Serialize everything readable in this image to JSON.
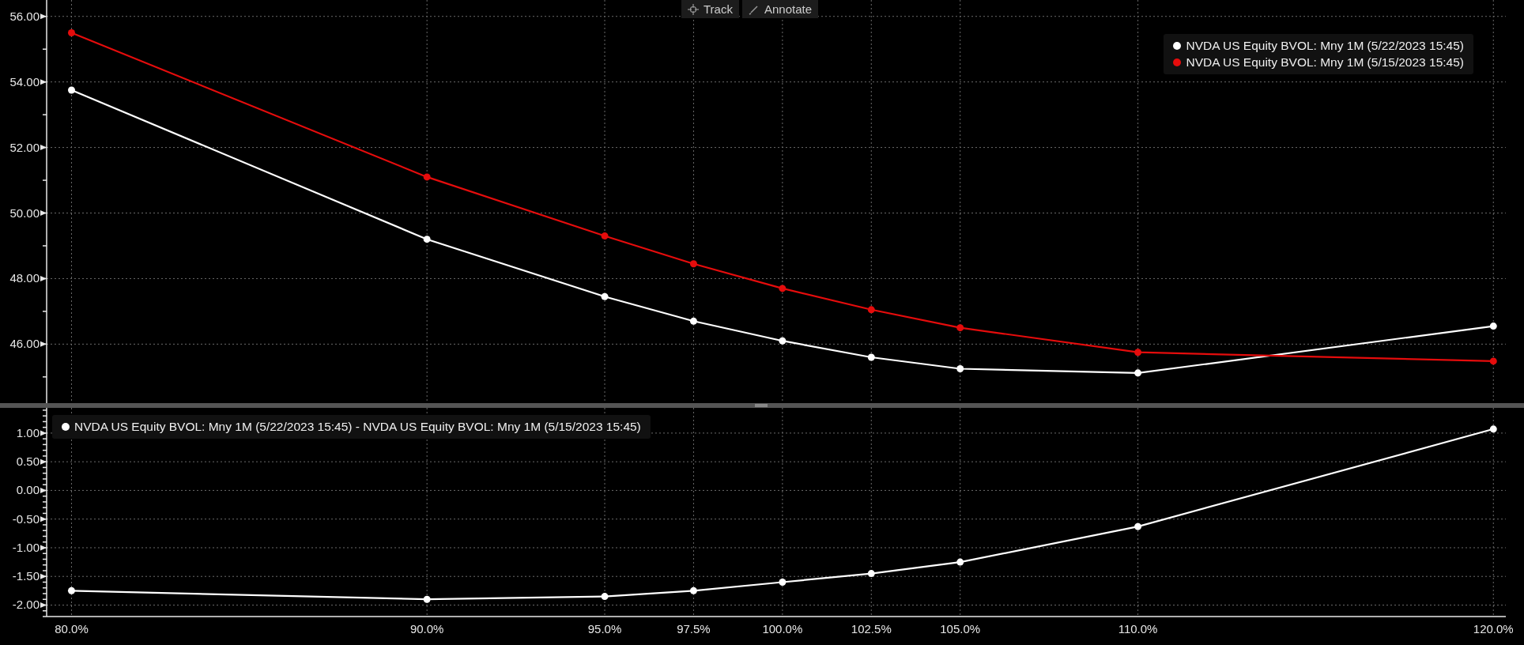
{
  "toolbar": [
    {
      "kind": "track",
      "label": "Track"
    },
    {
      "kind": "annotate",
      "label": "Annotate"
    }
  ],
  "top_panel": {
    "chart_data": {
      "type": "line",
      "x": [
        80,
        90,
        95,
        97.5,
        100,
        102.5,
        105,
        110,
        120
      ],
      "xlim": [
        79.3,
        120.35
      ],
      "ylim": [
        44.2,
        56.5
      ],
      "grid": true,
      "yticks": [
        {
          "value": 46,
          "label": "46.00"
        },
        {
          "value": 48,
          "label": "48.00"
        },
        {
          "value": 50,
          "label": "50.00"
        },
        {
          "value": 52,
          "label": "52.00"
        },
        {
          "value": 54,
          "label": "54.00"
        },
        {
          "value": 56,
          "label": "56.00"
        }
      ],
      "series": [
        {
          "name": "NVDA US Equity BVOL: Mny 1M (5/22/2023 15:45)",
          "color": "#ffffff",
          "marker": true,
          "values": [
            53.75,
            49.2,
            47.45,
            46.7,
            46.1,
            45.6,
            45.25,
            45.12,
            46.55
          ]
        },
        {
          "name": "NVDA US Equity BVOL: Mny 1M (5/15/2023 15:45)",
          "color": "#e50c0c",
          "marker": true,
          "values": [
            55.5,
            51.1,
            49.3,
            48.45,
            47.7,
            47.05,
            46.5,
            45.75,
            45.48
          ]
        }
      ]
    }
  },
  "bottom_panel": {
    "chart_data": {
      "type": "line",
      "x": [
        80,
        90,
        95,
        97.5,
        100,
        102.5,
        105,
        110,
        120
      ],
      "xlim": [
        79.3,
        120.35
      ],
      "ylim": [
        -2.2,
        1.44
      ],
      "grid": true,
      "xticks": [
        {
          "value": 80,
          "label": "80.0%"
        },
        {
          "value": 90,
          "label": "90.0%"
        },
        {
          "value": 95,
          "label": "95.0%"
        },
        {
          "value": 97.5,
          "label": "97.5%"
        },
        {
          "value": 100,
          "label": "100.0%"
        },
        {
          "value": 102.5,
          "label": "102.5%"
        },
        {
          "value": 105,
          "label": "105.0%"
        },
        {
          "value": 110,
          "label": "110.0%"
        },
        {
          "value": 120,
          "label": "120.0%"
        }
      ],
      "yticks": [
        {
          "value": -2,
          "label": "-2.00"
        },
        {
          "value": -1.5,
          "label": "-1.50"
        },
        {
          "value": -1,
          "label": "-1.00"
        },
        {
          "value": -0.5,
          "label": "-0.50"
        },
        {
          "value": 0,
          "label": "0.00"
        },
        {
          "value": 0.5,
          "label": "0.50"
        },
        {
          "value": 1,
          "label": "1.00"
        }
      ],
      "series": [
        {
          "name": "NVDA US Equity BVOL: Mny 1M (5/22/2023 15:45) - NVDA US Equity BVOL: Mny 1M (5/15/2023 15:45)",
          "color": "#ffffff",
          "marker": true,
          "values": [
            -1.75,
            -1.9,
            -1.85,
            -1.75,
            -1.6,
            -1.45,
            -1.25,
            -0.63,
            1.07
          ]
        }
      ]
    }
  }
}
